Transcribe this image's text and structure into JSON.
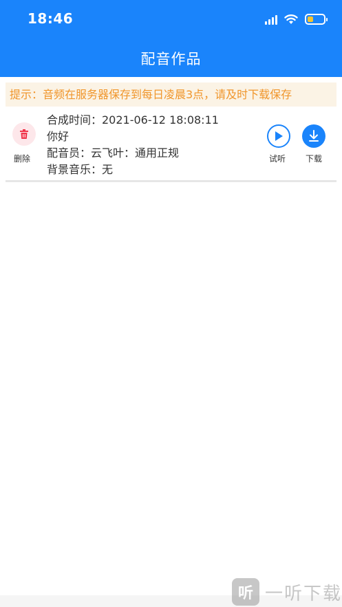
{
  "status_bar": {
    "time": "18:46"
  },
  "header": {
    "title": "配音作品"
  },
  "notice": {
    "text": "提示：音频在服务器保存到每日凌晨3点，请及时下载保存"
  },
  "works": [
    {
      "synth_time": "合成时间：2021-06-12 18:08:11",
      "text": "你好",
      "voice": "配音员：云飞叶：通用正规",
      "bgm": "背景音乐：无",
      "delete_label": "删除",
      "listen_label": "试听",
      "download_label": "下载"
    }
  ],
  "watermark": {
    "logo": "听",
    "text": "一听下载"
  },
  "colors": {
    "accent": "#1a84fb",
    "notice_text": "#f0952a",
    "notice_bg": "#fbf3e5",
    "delete_red": "#f0344a"
  }
}
